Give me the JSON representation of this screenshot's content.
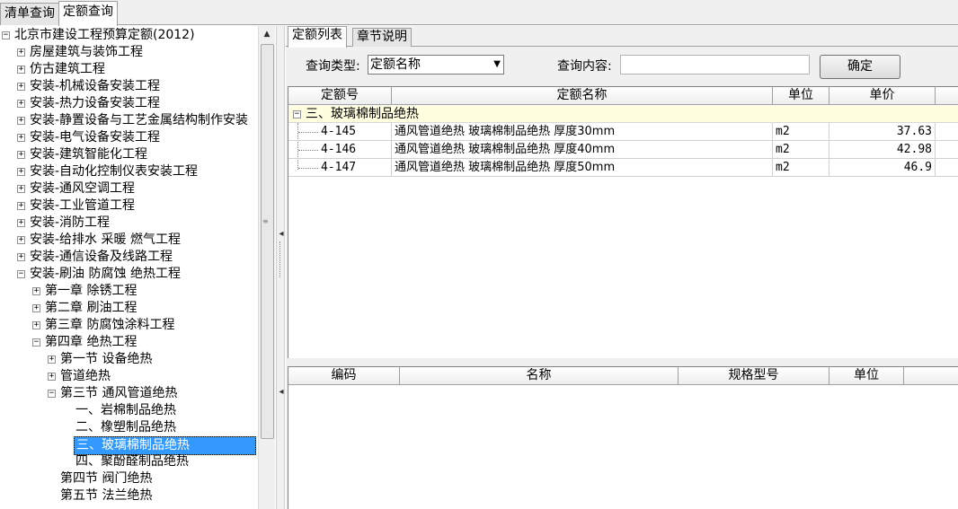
{
  "top_tabs": [
    {
      "label": "清单查询",
      "active": false
    },
    {
      "label": "定额查询",
      "active": true
    }
  ],
  "tree": {
    "items": [
      {
        "label": "北京市建设工程预算定额(2012)",
        "indent": 0,
        "expander": "minus"
      },
      {
        "label": "房屋建筑与装饰工程",
        "indent": 1,
        "expander": "plus"
      },
      {
        "label": "仿古建筑工程",
        "indent": 1,
        "expander": "plus"
      },
      {
        "label": "安装-机械设备安装工程",
        "indent": 1,
        "expander": "plus"
      },
      {
        "label": "安装-热力设备安装工程",
        "indent": 1,
        "expander": "plus"
      },
      {
        "label": "安装-静置设备与工艺金属结构制作安装",
        "indent": 1,
        "expander": "plus"
      },
      {
        "label": "安装-电气设备安装工程",
        "indent": 1,
        "expander": "plus"
      },
      {
        "label": "安装-建筑智能化工程",
        "indent": 1,
        "expander": "plus"
      },
      {
        "label": "安装-自动化控制仪表安装工程",
        "indent": 1,
        "expander": "plus"
      },
      {
        "label": "安装-通风空调工程",
        "indent": 1,
        "expander": "plus"
      },
      {
        "label": "安装-工业管道工程",
        "indent": 1,
        "expander": "plus"
      },
      {
        "label": "安装-消防工程",
        "indent": 1,
        "expander": "plus"
      },
      {
        "label": "安装-给排水 采暖 燃气工程",
        "indent": 1,
        "expander": "plus"
      },
      {
        "label": "安装-通信设备及线路工程",
        "indent": 1,
        "expander": "plus"
      },
      {
        "label": "安装-刷油 防腐蚀 绝热工程",
        "indent": 1,
        "expander": "minus"
      },
      {
        "label": "第一章 除锈工程",
        "indent": 2,
        "expander": "plus"
      },
      {
        "label": "第二章 刷油工程",
        "indent": 2,
        "expander": "plus"
      },
      {
        "label": "第三章 防腐蚀涂料工程",
        "indent": 2,
        "expander": "plus"
      },
      {
        "label": "第四章 绝热工程",
        "indent": 2,
        "expander": "minus"
      },
      {
        "label": "第一节 设备绝热",
        "indent": 3,
        "expander": "plus"
      },
      {
        "label": "管道绝热",
        "indent": 3,
        "expander": "plus"
      },
      {
        "label": "第三节 通风管道绝热",
        "indent": 3,
        "expander": "minus"
      },
      {
        "label": "一、岩棉制品绝热",
        "indent": 4,
        "expander": "none"
      },
      {
        "label": "二、橡塑制品绝热",
        "indent": 4,
        "expander": "none"
      },
      {
        "label": "三、玻璃棉制品绝热",
        "indent": 4,
        "expander": "none",
        "selected": true
      },
      {
        "label": "四、聚酚醛制品绝热",
        "indent": 4,
        "expander": "none"
      },
      {
        "label": "第四节 阀门绝热",
        "indent": 3,
        "expander": "none"
      },
      {
        "label": "第五节 法兰绝热",
        "indent": 3,
        "expander": "none"
      }
    ]
  },
  "sub_tabs": [
    {
      "label": "定额列表",
      "active": true
    },
    {
      "label": "章节说明",
      "active": false
    }
  ],
  "query": {
    "type_label": "查询类型:",
    "type_value": "定额名称",
    "content_label": "查询内容:",
    "content_value": "",
    "confirm_label": "确定"
  },
  "quota_table": {
    "headers": [
      "定额号",
      "定额名称",
      "单位",
      "单价"
    ],
    "group_label": "三、玻璃棉制品绝热",
    "rows": [
      {
        "code": "4-145",
        "name": "通风管道绝热 玻璃棉制品绝热 厚度30mm",
        "unit": "m2",
        "price": "37.63"
      },
      {
        "code": "4-146",
        "name": "通风管道绝热 玻璃棉制品绝热 厚度40mm",
        "unit": "m2",
        "price": "42.98"
      },
      {
        "code": "4-147",
        "name": "通风管道绝热 玻璃棉制品绝热 厚度50mm",
        "unit": "m2",
        "price": "46.9"
      }
    ]
  },
  "material_table": {
    "headers": [
      "编码",
      "名称",
      "规格型号",
      "单位"
    ]
  },
  "colors": {
    "selection": "#3399ff",
    "group_row_bg": "#ffffe0",
    "panel_bg": "#f0f0f0"
  }
}
